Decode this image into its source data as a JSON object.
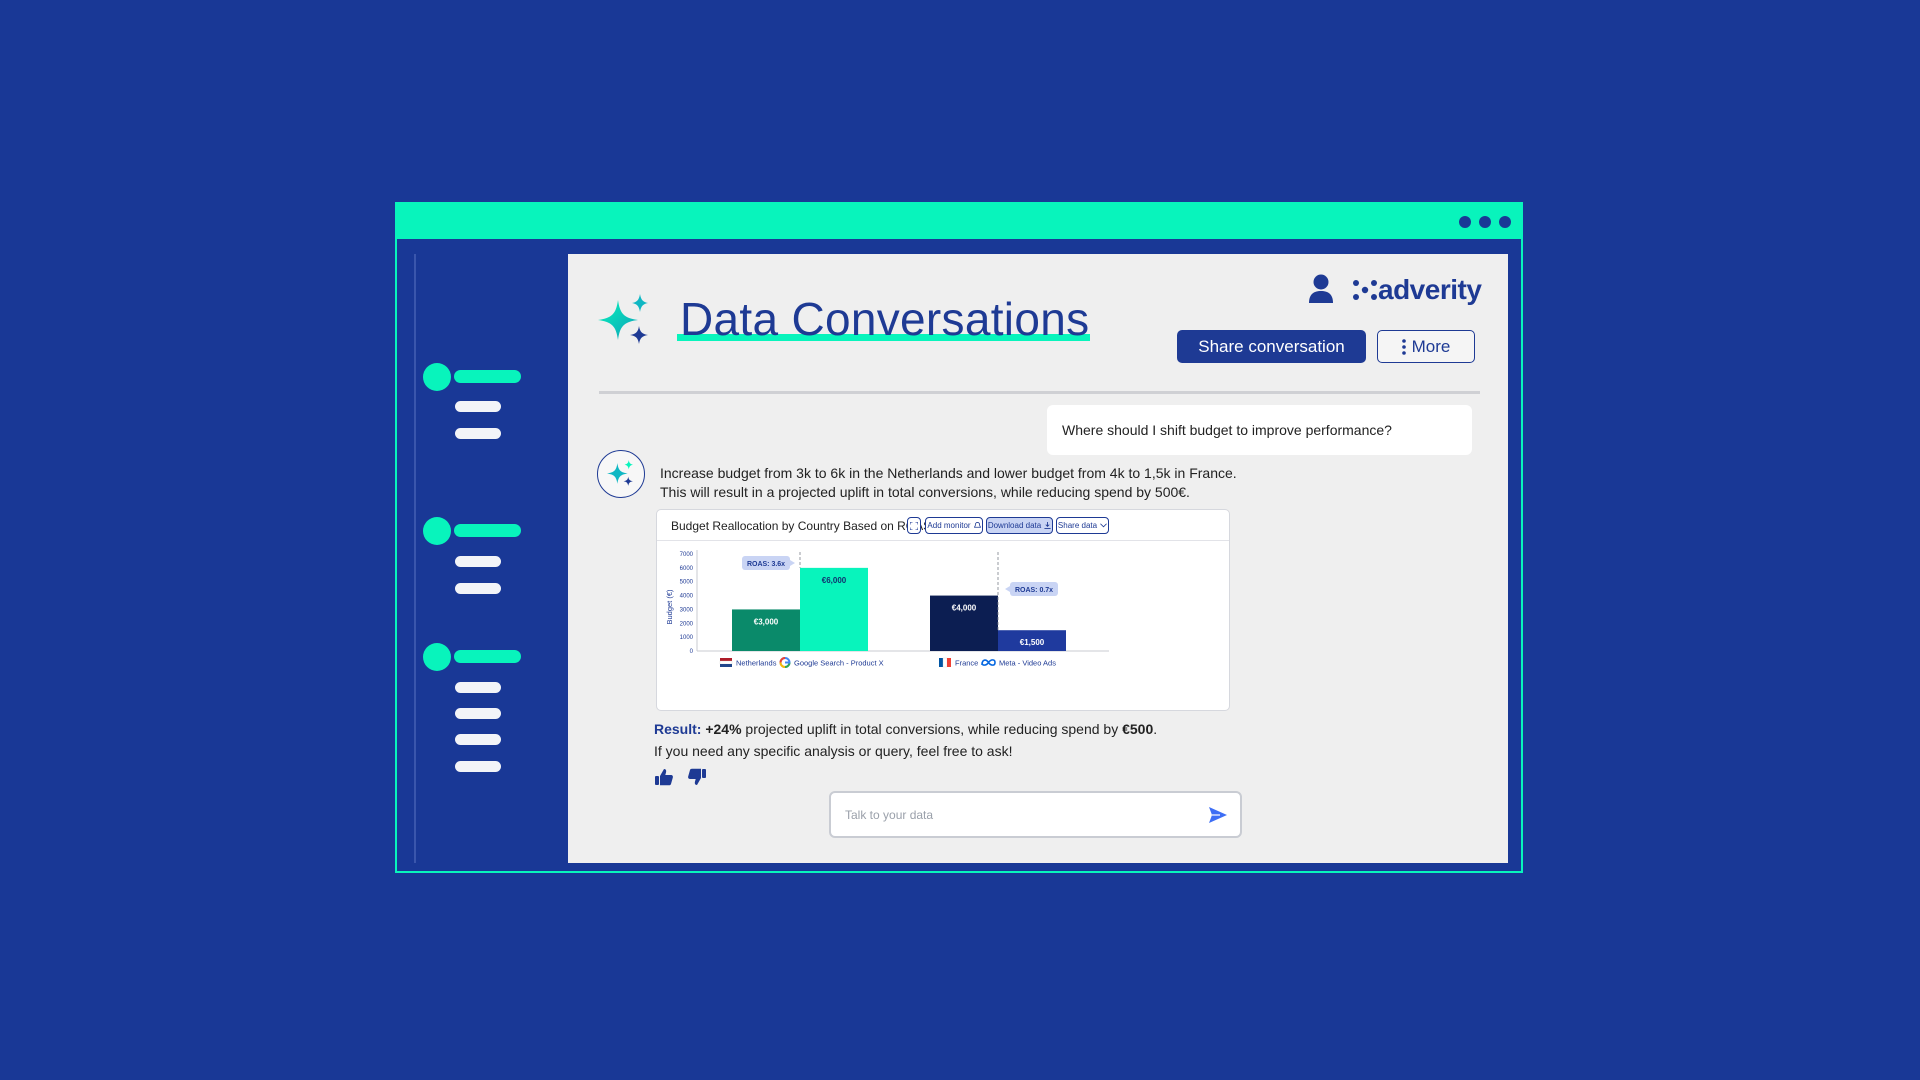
{
  "app": {
    "title": "Data Conversations",
    "logo_text": "adverity",
    "share_button": "Share conversation",
    "more_button": "More"
  },
  "colors": {
    "background": "#193896",
    "accent": "#08f4bc",
    "brand_blue": "#1e3a94",
    "bar_netherlands": "#0a8a6a",
    "bar_google": "#08f4bc",
    "bar_france": "#0c1e52",
    "bar_meta": "#1f3a9e"
  },
  "icons": {
    "sparkle": "sparkle-icon",
    "user": "user-icon",
    "more": "vertical-dots-icon",
    "send": "send-icon",
    "thumbs_up": "thumbs-up-icon",
    "thumbs_down": "thumbs-down-icon"
  },
  "conversation": {
    "user_message": "Where should I shift budget to improve performance?",
    "ai_line1": "Increase budget from 3k to 6k in the Netherlands and lower budget from 4k to 1,5k in France.",
    "ai_line2": "This will result in a projected uplift in total conversions, while reducing spend by 500€.",
    "result_label": "Result:",
    "result_value": "+24%",
    "result_mid": " projected uplift in total conversions, while reducing spend by ",
    "result_amount": "€500",
    "result_end": ".",
    "followup": "If you need any specific analysis or query, feel free to ask!"
  },
  "chart_card": {
    "title": "Budget Reallocation by Country Based on ROAS",
    "add_monitor": "Add monitor",
    "download_data": "Download data",
    "share_data": "Share data"
  },
  "chart_data": {
    "type": "bar",
    "title": "Budget Reallocation by Country Based on ROAS",
    "ylabel": "Budget (€)",
    "xlabel": "",
    "ylim": [
      0,
      7000
    ],
    "yticks": [
      0,
      1000,
      2000,
      3000,
      4000,
      5000,
      6000,
      7000
    ],
    "groups": [
      {
        "country": "Netherlands",
        "channel": "Google Search - Product X",
        "roas": "ROAS: 3.6x",
        "bars": [
          {
            "value": 3000,
            "label": "€3,000"
          },
          {
            "value": 6000,
            "label": "€6,000"
          }
        ]
      },
      {
        "country": "France",
        "channel": "Meta - Video Ads",
        "roas": "ROAS: 0.7x",
        "bars": [
          {
            "value": 4000,
            "label": "€4,000"
          },
          {
            "value": 1500,
            "label": "€1,500"
          }
        ]
      }
    ]
  },
  "input": {
    "placeholder": "Talk to your data"
  }
}
